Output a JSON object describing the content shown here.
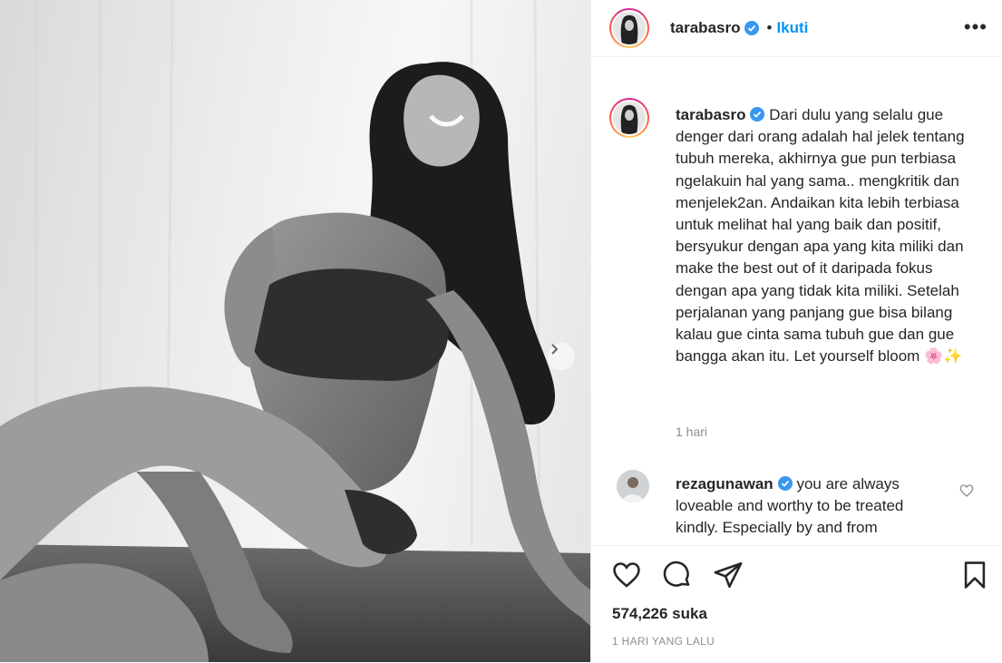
{
  "post": {
    "username": "tarabasro",
    "follow_label": "Ikuti",
    "separator": "•",
    "more_label": "•••",
    "caption": {
      "username": "tarabasro",
      "text": "Dari dulu yang selalu gue denger dari orang adalah hal jelek tentang tubuh mereka, akhirnya gue pun terbiasa ngelakuin hal yang sama.. mengkritik dan menjelek2an. Andaikan kita lebih terbiasa untuk melihat hal yang baik dan positif, bersyukur dengan apa yang kita miliki dan make the best out of it daripada fokus dengan apa yang tidak kita miliki. Setelah perjalanan yang panjang gue bisa bilang kalau gue cinta sama tubuh gue dan gue bangga akan itu. Let yourself bloom 🌸✨",
      "time": "1 hari"
    },
    "comment": {
      "username": "rezagunawan",
      "text": "you are always loveable and worthy to be treated kindly. Especially by and from"
    },
    "likes": "574,226 suka",
    "date": "1 HARI YANG LALU",
    "colors": {
      "accent": "#0095f6",
      "verified": "#3897f0",
      "text": "#262626",
      "muted": "#8e8e8e"
    }
  }
}
